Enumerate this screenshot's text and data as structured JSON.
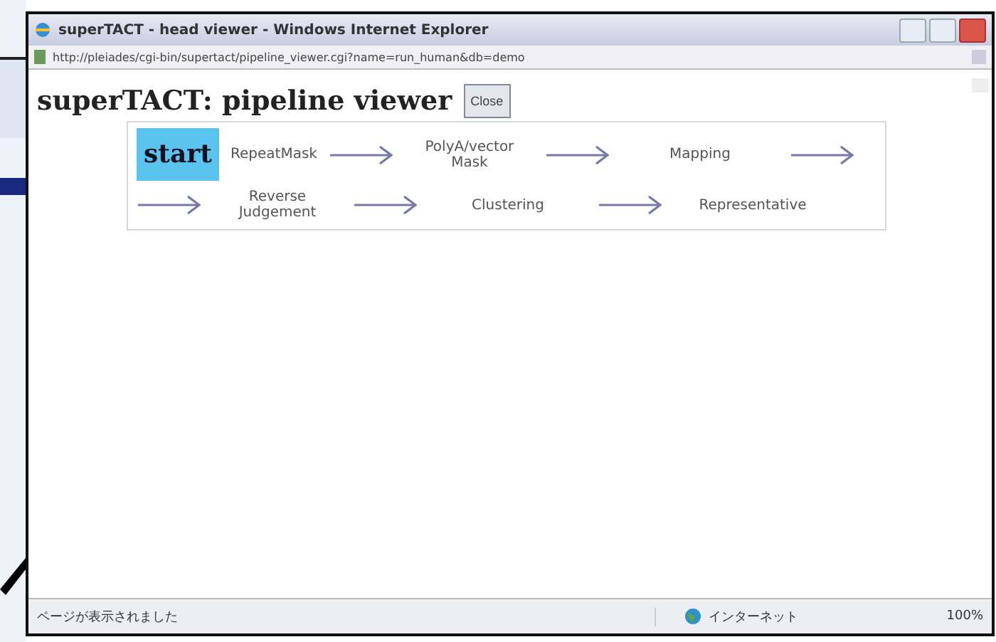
{
  "window": {
    "title": "superTACT - head viewer - Windows Internet Explorer"
  },
  "address": "http://pleiades/cgi-bin/supertact/pipeline_viewer.cgi?name=run_human&db=demo",
  "page": {
    "heading": "superTACT: pipeline viewer",
    "close_button": "Close"
  },
  "pipeline": [
    [
      {
        "kind": "stage",
        "label": "start",
        "selected": true
      },
      {
        "kind": "stage",
        "label": "RepeatMask",
        "selected": false
      },
      {
        "kind": "arrow"
      },
      {
        "kind": "stage",
        "label": "PolyA/vector Mask",
        "selected": false
      },
      {
        "kind": "arrow"
      },
      {
        "kind": "stage",
        "label": "Mapping",
        "selected": false
      },
      {
        "kind": "arrow"
      }
    ],
    [
      {
        "kind": "arrow"
      },
      {
        "kind": "stage",
        "label": "Reverse Judgement",
        "selected": false
      },
      {
        "kind": "arrow"
      },
      {
        "kind": "stage",
        "label": "Clustering",
        "selected": false
      },
      {
        "kind": "arrow"
      },
      {
        "kind": "stage",
        "label": "Representative",
        "selected": false
      }
    ]
  ],
  "status_bar": {
    "message": "ページが表示されました",
    "zone": "インターネット",
    "zoom": "100%"
  }
}
